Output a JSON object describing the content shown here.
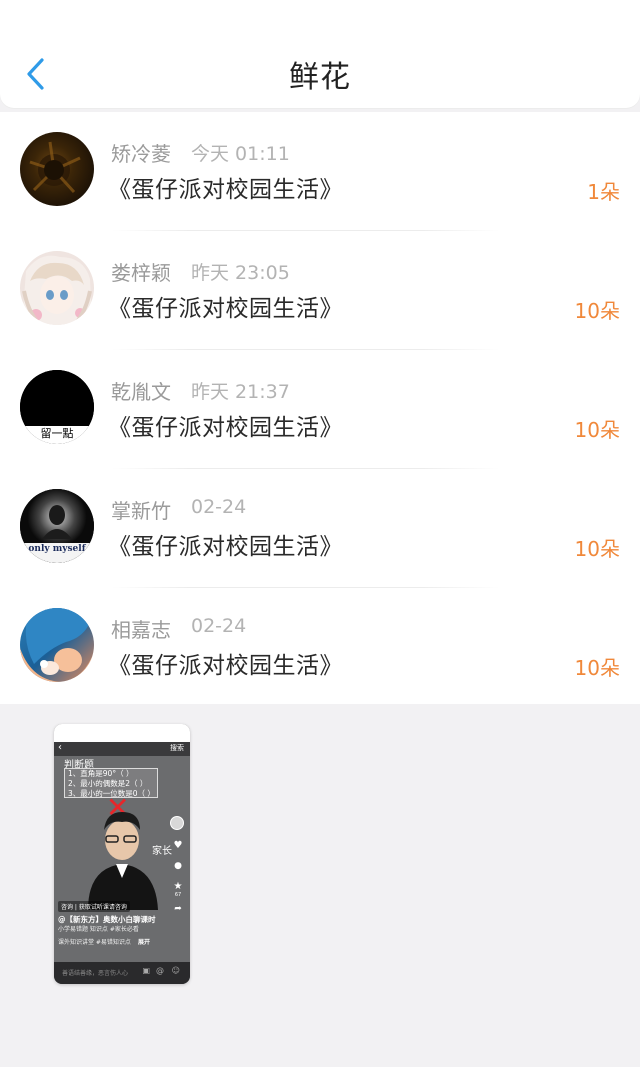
{
  "header": {
    "title": "鲜花",
    "back_icon": "chevron-left-icon"
  },
  "colors": {
    "accent_blue": "#2f9be8",
    "count_orange": "#f0883a"
  },
  "list": [
    {
      "name": "矫冷菱",
      "time": "今天 01:11",
      "book": "《蛋仔派对校园生活》",
      "count": "1朵"
    },
    {
      "name": "娄梓颖",
      "time": "昨天 23:05",
      "book": "《蛋仔派对校园生活》",
      "count": "10朵"
    },
    {
      "name": "乾胤文",
      "time": "昨天 21:37",
      "book": "《蛋仔派对校园生活》",
      "count": "10朵",
      "avatar_text": "留一點"
    },
    {
      "name": "掌新竹",
      "time": "02-24",
      "book": "《蛋仔派对校园生活》",
      "count": "10朵",
      "avatar_text": "only myself"
    },
    {
      "name": "相嘉志",
      "time": "02-24",
      "book": "《蛋仔派对校园生活》",
      "count": "10朵"
    }
  ],
  "thumbnail": {
    "search_label": "搜索",
    "quiz_title": "判断题",
    "quiz_lines": [
      "1、直角是90°（ ）",
      "2、最小的偶数是2（ ）",
      "3、最小的一位数是0（ ）"
    ],
    "mark": "✕",
    "side_label": "家长",
    "ad_text": "咨询 | 获取试听课请咨询",
    "caption": "@【新东方】奥数小白聊课时",
    "sub_caption": "小学易错题 知识点 #家长必看",
    "sub_caption2": "课外知识讲堂 #易错知识点",
    "more_label": "展开",
    "comment_placeholder": "善语结善缘，恶言伤人心",
    "like_count": "",
    "share_count": "67"
  }
}
